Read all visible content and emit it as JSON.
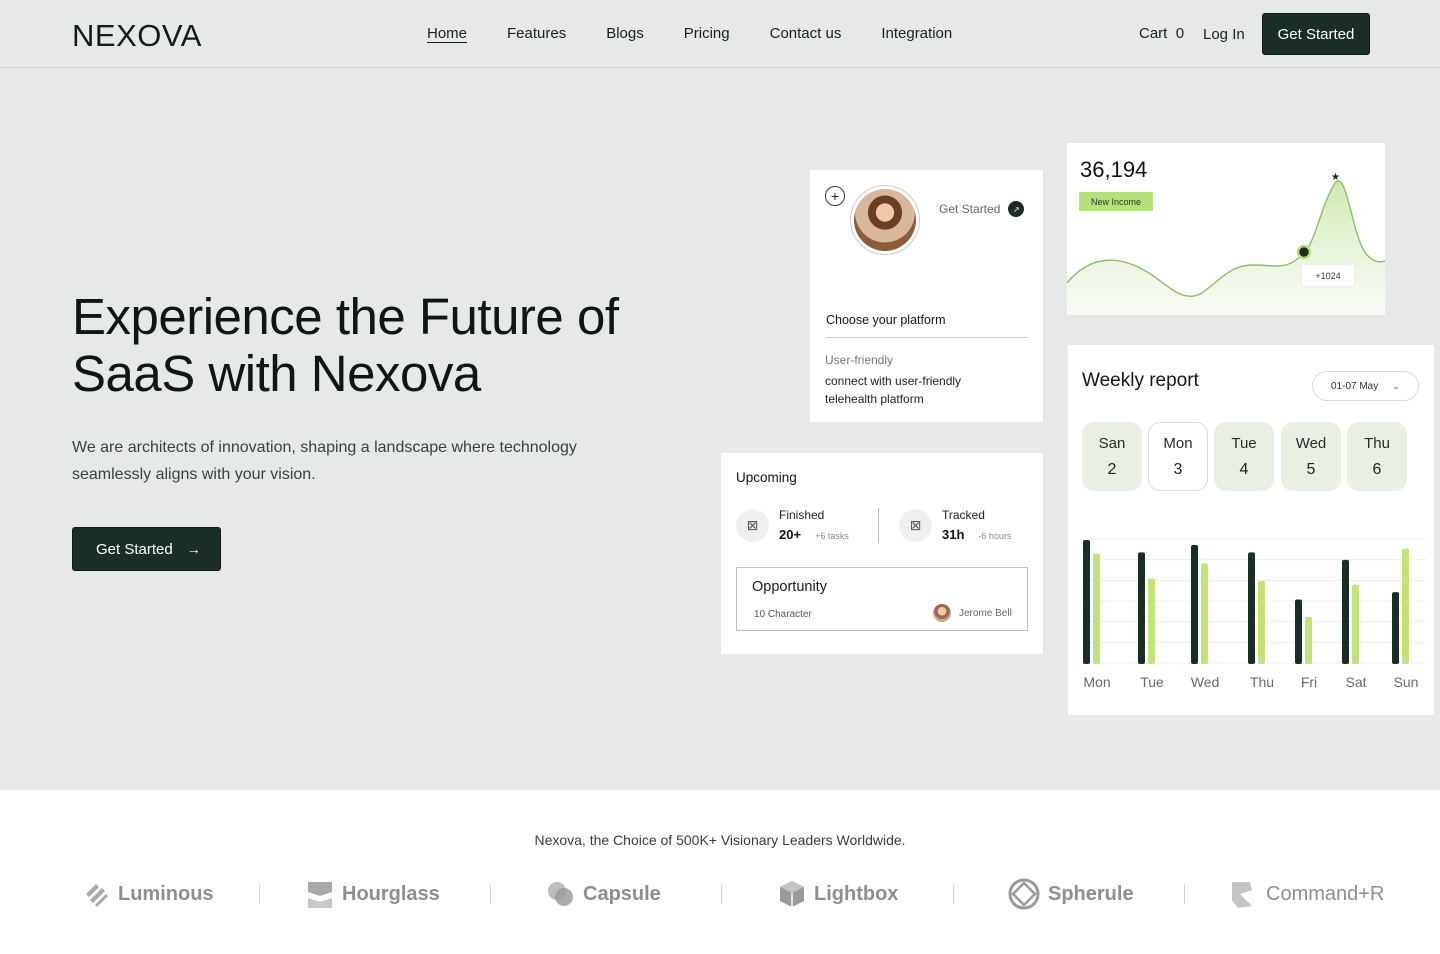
{
  "nav": {
    "logo": "NEXOVA",
    "links": [
      "Home",
      "Features",
      "Blogs",
      "Pricing",
      "Contact us",
      "Integration"
    ],
    "cart_label": "Cart",
    "cart_count": "0",
    "login": "Log In",
    "cta": "Get Started"
  },
  "hero": {
    "title": "Experience the Future of SaaS with Nexova",
    "subtitle": "We are architects of innovation, shaping a landscape where technology seamlessly aligns with your vision.",
    "cta": "Get Started",
    "cta_icon": "arrow-right-icon"
  },
  "profile_card": {
    "plus_icon": "+",
    "get_started": "Get Started",
    "platform_title": "Choose your platform",
    "caption": "User-friendly",
    "description": "connect with user-friendly telehealth platform"
  },
  "income_card": {
    "value": "36,194",
    "badge": "New Income",
    "tooltip": "+1024",
    "star": "★"
  },
  "upcoming_card": {
    "title": "Upcoming",
    "finished": {
      "label": "Finished",
      "value": "20+",
      "note": "+6 tasks"
    },
    "tracked": {
      "label": "Tracked",
      "value": "31h",
      "note": "-6 hours"
    },
    "opportunity": {
      "title": "Opportunity",
      "sub": "10 Character",
      "user": "Jerome Bell"
    }
  },
  "weekly_card": {
    "title": "Weekly report",
    "range": "01-07 May",
    "days": [
      {
        "name": "San",
        "num": "2"
      },
      {
        "name": "Mon",
        "num": "3"
      },
      {
        "name": "Tue",
        "num": "4"
      },
      {
        "name": "Wed",
        "num": "5"
      },
      {
        "name": "Thu",
        "num": "6"
      }
    ],
    "selected_day": "Mon"
  },
  "chart_data": {
    "type": "bar",
    "categories": [
      "Mon",
      "Tue",
      "Wed",
      "Thu",
      "Fri",
      "Sat",
      "Sun"
    ],
    "series": [
      {
        "values": [
          100,
          90,
          96,
          90,
          52,
          84,
          58
        ]
      },
      {
        "values": [
          89,
          69,
          81,
          67,
          38,
          64,
          93
        ]
      }
    ],
    "ylim": [
      0,
      100
    ],
    "colors": [
      "#1a2e27",
      "#c3e27a"
    ],
    "grid": true
  },
  "logos": {
    "tagline": "Nexova, the Choice of 500K+ Visionary Leaders Worldwide.",
    "items": [
      "Luminous",
      "Hourglass",
      "Capsule",
      "Lightbox",
      "Spherule",
      "Command+R"
    ]
  },
  "colors": {
    "accent": "#1a2e27",
    "highlight": "#b5e07a",
    "hero_bg": "#e6e9e7"
  }
}
